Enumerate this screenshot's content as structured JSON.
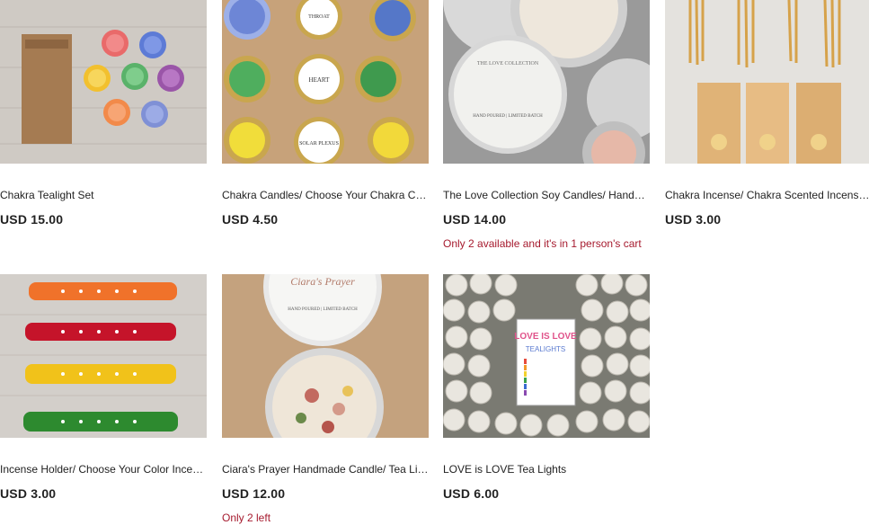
{
  "products": [
    {
      "title": "Chakra Tealight Set",
      "price": "USD 15.00",
      "stock": ""
    },
    {
      "title": "Chakra Candles/ Choose Your Chakra Candle",
      "price": "USD 4.50",
      "stock": ""
    },
    {
      "title": "The Love Collection Soy Candles/ Handmade",
      "price": "USD 14.00",
      "stock": "Only 2 available and it's in 1 person's cart"
    },
    {
      "title": "Chakra Incense/ Chakra Scented Incense Sticks",
      "price": "USD 3.00",
      "stock": ""
    },
    {
      "title": "Incense Holder/ Choose Your Color Incense Holder",
      "price": "USD 3.00",
      "stock": ""
    },
    {
      "title": "Ciara's Prayer Handmade Candle/ Tea Light",
      "price": "USD 12.00",
      "stock": "Only 2 left"
    },
    {
      "title": "LOVE is LOVE Tea Lights",
      "price": "USD 6.00",
      "stock": ""
    }
  ],
  "image_text": {
    "heart_label": "HEART",
    "solar_label": "SOLAR PLEXUS",
    "throat_label": "THROAT",
    "love_collection": "THE LOVE COLLECTION",
    "hand_poured": "HAND POURED | LIMITED BATCH",
    "ciaras_prayer": "Ciara's Prayer",
    "love_is_love": "LOVE IS LOVE",
    "tealights": "TEALIGHTS"
  },
  "colors": {
    "price": "#222222",
    "stock_warning": "#a61a2e",
    "wood": "#c7a27a"
  }
}
